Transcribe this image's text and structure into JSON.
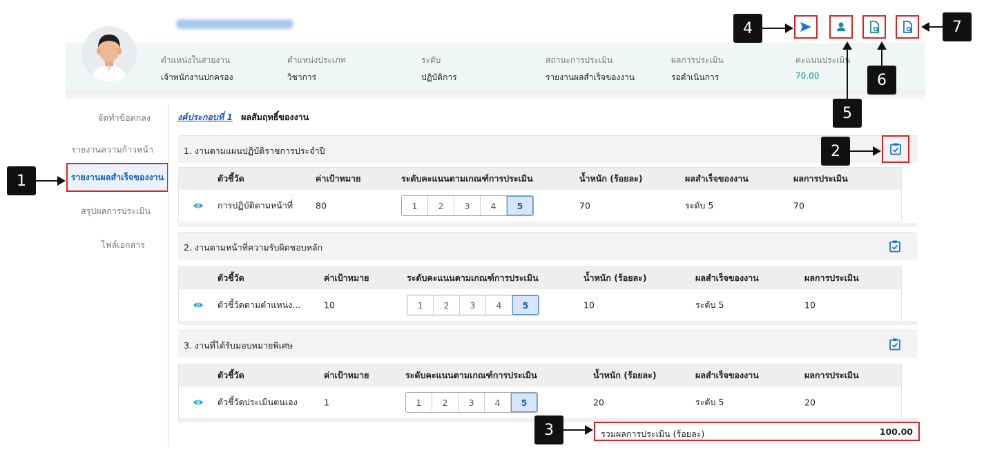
{
  "profile": {
    "columns": [
      {
        "label": "ตำแหน่งในสายงาน",
        "value": "เจ้าพนักงานปกครอง"
      },
      {
        "label": "ตำแหน่งประเภท",
        "value": "วิชาการ"
      },
      {
        "label": "ระดับ",
        "value": "ปฏิบัติการ"
      },
      {
        "label": "สถานะการประเมิน",
        "value": "รายงานผลสำเร็จของงาน"
      },
      {
        "label": "ผลการประเมิน",
        "value": "รอดำเนินการ"
      },
      {
        "label": "คะแนนประเมิน",
        "value": "70.00"
      }
    ]
  },
  "toolbar": {
    "icons": [
      "send-icon",
      "person-icon",
      "document-search-icon",
      "document-search-icon"
    ],
    "accent": "#1a73d9"
  },
  "callouts": [
    "1",
    "2",
    "3",
    "4",
    "5",
    "6",
    "7"
  ],
  "sidebar": {
    "items": [
      {
        "label": "จัดทำข้อตกลง"
      },
      {
        "label": "รายงานความก้าวหน้า"
      },
      {
        "label": "รายงานผลสำเร็จของงาน"
      },
      {
        "label": "สรุปผลการประเมิน"
      },
      {
        "label": "ไฟล์เอกสาร"
      }
    ]
  },
  "breadcrumb": {
    "link": "งค์ประกอบที่ 1",
    "title": "ผลสัมฤทธิ์ของงาน"
  },
  "table_headers": [
    "ตัวชี้วัด",
    "ค่าเป้าหมาย",
    "ระดับคะแนนตามเกณฑ์การประเมิน",
    "น้ำหนัก (ร้อยละ)",
    "ผลสำเร็จของงาน",
    "ผลการประเมิน"
  ],
  "score_levels": [
    "1",
    "2",
    "3",
    "4",
    "5"
  ],
  "sections": [
    {
      "title": "1. งานตามแผนปฏิบัติราชการประจำปี",
      "row": {
        "indicator": "การปฏิบัติตามหน้าที่",
        "target": "80",
        "selected": 5,
        "weight": "70",
        "achievement": "ระดับ 5",
        "result": "70"
      }
    },
    {
      "title": "2. งานตามหน้าที่ความรับผิดชอบหลัก",
      "row": {
        "indicator": "ตัวชี้วัดตามตำแหน่ง...",
        "target": "10",
        "selected": 5,
        "weight": "10",
        "achievement": "ระดับ 5",
        "result": "10"
      }
    },
    {
      "title": "3. งานที่ได้รับมอบหมายพิเศษ",
      "row": {
        "indicator": "ตัวชี้วัดประเมินตนเอง",
        "target": "1",
        "selected": 5,
        "weight": "20",
        "achievement": "ระดับ 5",
        "result": "20"
      }
    }
  ],
  "total": {
    "label": "รวมผลการประเมิน (ร้อยละ)",
    "value": "100.00"
  },
  "colors": {
    "highlight": "#e02020",
    "link": "#1a5fb4",
    "teal": "#178f8a",
    "eye": "#1aa3c4"
  }
}
